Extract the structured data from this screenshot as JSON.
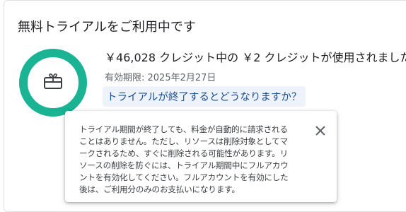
{
  "title": "無料トライアルをご利用中です",
  "credits": {
    "total_prefix": "￥",
    "total": "46,028",
    "mid_text": " クレジット中の ",
    "used_prefix": "￥",
    "used": "2",
    "suffix": " クレジットが使用されました"
  },
  "expiry": {
    "label": "有効期限: ",
    "date": "2025年2月27日"
  },
  "faq_link": "トライアルが終了するとどうなりますか？",
  "tooltip": {
    "lines": [
      "トライアル期間が終了しても、料金が自動的に請求される",
      "ことはありません。ただし、リソースは削除対象としてマ",
      "ークされるため、すぐに削除される可能性があります。リ",
      "ソースの削除を防ぐには、トライアル期間中にフルアカウ",
      "ントを有効化してください。フルアカウントを有効にした",
      "後は、ご利用分のみのお支払いになります。"
    ]
  },
  "progress": {
    "used_fraction": 4e-05,
    "ring_color": "#1ab394",
    "track_color": "#e6e6e6"
  },
  "icons": {
    "gift": "gift-card-icon",
    "close": "close-icon"
  }
}
